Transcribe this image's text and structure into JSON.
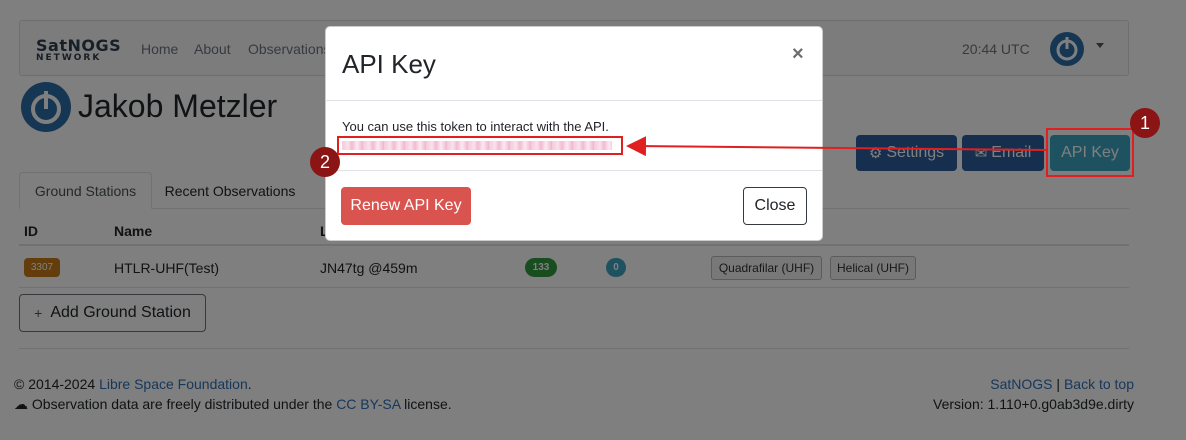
{
  "navbar": {
    "logo_line1": "SatNOGS",
    "logo_line2": "NETWORK",
    "links": [
      "Home",
      "About",
      "Observations"
    ],
    "time": "20:44 UTC"
  },
  "profile": {
    "name": "Jakob Metzler",
    "buttons": {
      "settings": "Settings",
      "email": "Email",
      "api_key": "API Key"
    }
  },
  "tabs": [
    "Ground Stations",
    "Recent Observations"
  ],
  "table": {
    "headers": [
      "ID",
      "Name",
      "L"
    ],
    "rows": [
      {
        "id": "3307",
        "name": "HTLR-UHF(Test)",
        "location": "JN47tg @459m",
        "good_count": "133",
        "future_count": "0",
        "antennas": [
          "Quadrafilar (UHF)",
          "Helical (UHF)"
        ]
      }
    ]
  },
  "add_station_label": "Add Ground Station",
  "footer": {
    "copyright_prefix": "2014-2024",
    "org_link": "Libre Space Foundation",
    "org_suffix": ".",
    "data_text_prefix": "Observation data are freely distributed under the",
    "license_link": "CC BY-SA",
    "data_text_suffix": "license.",
    "satnogs_link": "SatNOGS",
    "separator": "|",
    "back_to_top": "Back to top",
    "version": "Version: 1.110+0.g0ab3d9e.dirty"
  },
  "modal": {
    "title": "API Key",
    "close_glyph": "×",
    "description": "You can use this token to interact with the API.",
    "renew_label": "Renew API Key",
    "close_label": "Close"
  },
  "annotations": {
    "step1": "1",
    "step2": "2",
    "color": "#e02020"
  },
  "colors": {
    "primary": "#2f5f9c",
    "info": "#3fa4c2",
    "danger": "#d9534f",
    "success": "#2e9b3f",
    "id_badge": "#c77a18"
  }
}
